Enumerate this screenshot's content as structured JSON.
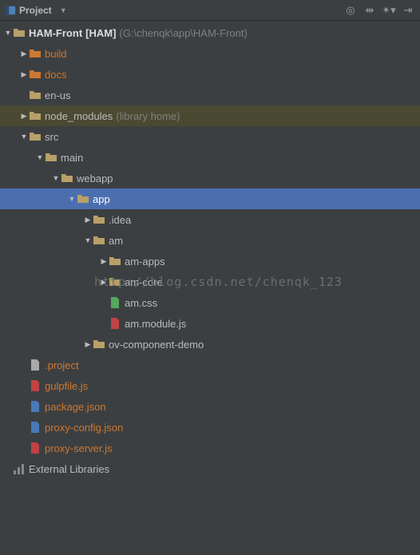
{
  "titlebar": {
    "title": "Project"
  },
  "tree": {
    "root": {
      "name": "HAM-Front",
      "module": "[HAM]",
      "path": "(G:\\chenqk\\app\\HAM-Front)"
    },
    "build": "build",
    "docs": "docs",
    "en_us": "en-us",
    "node_modules": "node_modules",
    "node_modules_annot": "(library home)",
    "src": "src",
    "main": "main",
    "webapp": "webapp",
    "app": "app",
    "idea": ".idea",
    "am": "am",
    "am_apps": "am-apps",
    "am_core": "am-core",
    "am_css": "am.css",
    "am_module_js": "am.module.js",
    "ov_component_demo": "ov-component-demo",
    "project_file": ".project",
    "gulpfile": "gulpfile.js",
    "package_json": "package.json",
    "proxy_config": "proxy-config.json",
    "proxy_server": "proxy-server.js",
    "external_libs": "External Libraries"
  },
  "watermark": "http://blog.csdn.net/chenqk_123"
}
